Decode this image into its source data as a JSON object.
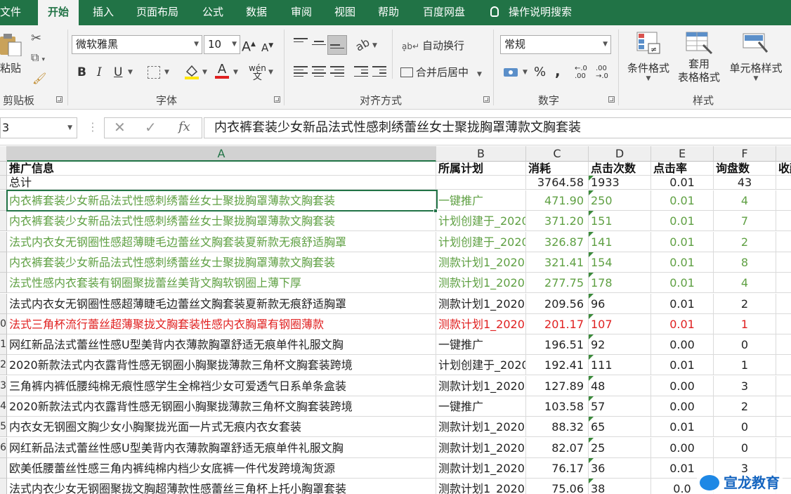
{
  "menu_tabs": [
    "文件",
    "开始",
    "插入",
    "页面布局",
    "公式",
    "数据",
    "审阅",
    "视图",
    "帮助",
    "百度网盘"
  ],
  "active_tab": "开始",
  "tell_me": "操作说明搜索",
  "ribbon": {
    "clipboard": {
      "paste": "粘贴",
      "group": "剪贴板"
    },
    "font": {
      "name": "微软雅黑",
      "size": "10",
      "group": "字体",
      "bold": "B",
      "italic": "I",
      "underline": "U",
      "font_color_letter": "A",
      "grow": "A",
      "shrink": "A",
      "phonetic": "wén"
    },
    "alignment": {
      "wrap_text": "自动换行",
      "merge_center": "合并后居中",
      "group": "对齐方式"
    },
    "number": {
      "format": "常规",
      "group": "数字",
      "percent": "%",
      "comma": ",",
      "inc_decimal": "←.0 .00",
      "dec_decimal": ".00 →.0"
    },
    "styles": {
      "conditional": "条件格式",
      "table_l1": "套用",
      "table_l2": "表格格式",
      "cell_styles": "单元格样式",
      "group": "样式"
    }
  },
  "formula_bar": {
    "name_box": "3",
    "fx": "fx",
    "content": "内衣裤套装少女新品法式性感刺绣蕾丝女士聚拢胸罩薄款文胸套装"
  },
  "columns": [
    "A",
    "B",
    "C",
    "D",
    "E",
    "F"
  ],
  "headers": [
    "推广信息",
    "所属计划",
    "消耗",
    "点击次数",
    "点击率",
    "询盘数",
    "收藏"
  ],
  "total": {
    "label": "总计",
    "cost": "3764.58",
    "clicks": "1933",
    "ctr": "0.01",
    "inquiries": "43"
  },
  "row_numbers": [
    "",
    "",
    "",
    "",
    "",
    "",
    "",
    "",
    "0",
    "1",
    "2",
    "3",
    "4",
    "5",
    "6",
    ""
  ],
  "rows": [
    {
      "info": "内衣裤套装少女新品法式性感刺绣蕾丝女士聚拢胸罩薄款文胸套装",
      "plan": "一键推广",
      "cost": "471.90",
      "clicks": "250",
      "ctr": "0.01",
      "inquiries": "4",
      "color": "green"
    },
    {
      "info": "内衣裤套装少女新品法式性感刺绣蕾丝女士聚拢胸罩薄款文胸套装",
      "plan": "计划创建于_2020",
      "cost": "371.20",
      "clicks": "151",
      "ctr": "0.01",
      "inquiries": "7",
      "color": "green"
    },
    {
      "info": "法式内衣女无钢圈性感超薄睫毛边蕾丝文胸套装夏新款无痕舒适胸罩",
      "plan": "计划创建于_2020",
      "cost": "326.87",
      "clicks": "141",
      "ctr": "0.01",
      "inquiries": "2",
      "color": "green"
    },
    {
      "info": "内衣裤套装少女新品法式性感刺绣蕾丝女士聚拢胸罩薄款文胸套装",
      "plan": "测款计划1_2020",
      "cost": "321.41",
      "clicks": "154",
      "ctr": "0.01",
      "inquiries": "8",
      "color": "green"
    },
    {
      "info": "法式性感内衣套装有钢圈聚拢蕾丝美背文胸软钢圈上薄下厚",
      "plan": "测款计划1_2020",
      "cost": "277.75",
      "clicks": "178",
      "ctr": "0.01",
      "inquiries": "4",
      "color": "green"
    },
    {
      "info": "法式内衣女无钢圈性感超薄睫毛边蕾丝文胸套装夏新款无痕舒适胸罩",
      "plan": "测款计划1_2020",
      "cost": "209.56",
      "clicks": "96",
      "ctr": "0.01",
      "inquiries": "2",
      "color": "black"
    },
    {
      "info": "法式三角杯流行蕾丝超薄聚拢文胸套装性感内衣胸罩有钢圈薄款",
      "plan": "测款计划1_2020",
      "cost": "201.17",
      "clicks": "107",
      "ctr": "0.01",
      "inquiries": "1",
      "color": "red"
    },
    {
      "info": "网红新品法式蕾丝性感U型美背内衣薄款胸罩舒适无痕单件礼服文胸",
      "plan": "一键推广",
      "cost": "196.51",
      "clicks": "92",
      "ctr": "0.00",
      "inquiries": "0",
      "color": "black"
    },
    {
      "info": "2020新款法式内衣露背性感无钢圈小胸聚拢薄款三角杯文胸套装跨境",
      "plan": "计划创建于_2020",
      "cost": "192.41",
      "clicks": "111",
      "ctr": "0.01",
      "inquiries": "1",
      "color": "black"
    },
    {
      "info": "三角裤内裤低腰纯棉无痕性感学生全棉裆少女可爱透气日系单条盒装",
      "plan": "测款计划1_2020",
      "cost": "127.89",
      "clicks": "48",
      "ctr": "0.00",
      "inquiries": "3",
      "color": "black"
    },
    {
      "info": "2020新款法式内衣露背性感无钢圈小胸聚拢薄款三角杯文胸套装跨境",
      "plan": "一键推广",
      "cost": "103.58",
      "clicks": "57",
      "ctr": "0.00",
      "inquiries": "2",
      "color": "black"
    },
    {
      "info": "内衣女无钢圈文胸少女小胸聚拢光面一片式无痕内衣女套装",
      "plan": "测款计划1_2020",
      "cost": "88.32",
      "clicks": "65",
      "ctr": "0.01",
      "inquiries": "0",
      "color": "black"
    },
    {
      "info": "网红新品法式蕾丝性感U型美背内衣薄款胸罩舒适无痕单件礼服文胸",
      "plan": "测款计划1_2020",
      "cost": "82.07",
      "clicks": "25",
      "ctr": "0.00",
      "inquiries": "0",
      "color": "black"
    },
    {
      "info": "欧美低腰蕾丝性感三角内裤纯棉内档少女底裤一件代发跨境淘货源",
      "plan": "测款计划1_2020",
      "cost": "76.17",
      "clicks": "36",
      "ctr": "0.01",
      "inquiries": "3",
      "color": "black"
    },
    {
      "info": "法式内衣少女无钢圈聚拢文胸超薄款性感蕾丝三角杯上托小胸罩套装",
      "plan": "测款计划1_2020",
      "cost": "75.06",
      "clicks": "38",
      "ctr": "0.0",
      "inquiries": "",
      "color": "black"
    }
  ],
  "watermark": "宣龙教育",
  "colors": {
    "excel_green": "#217346",
    "green_text": "#5fa043",
    "red_text": "#e02020"
  }
}
